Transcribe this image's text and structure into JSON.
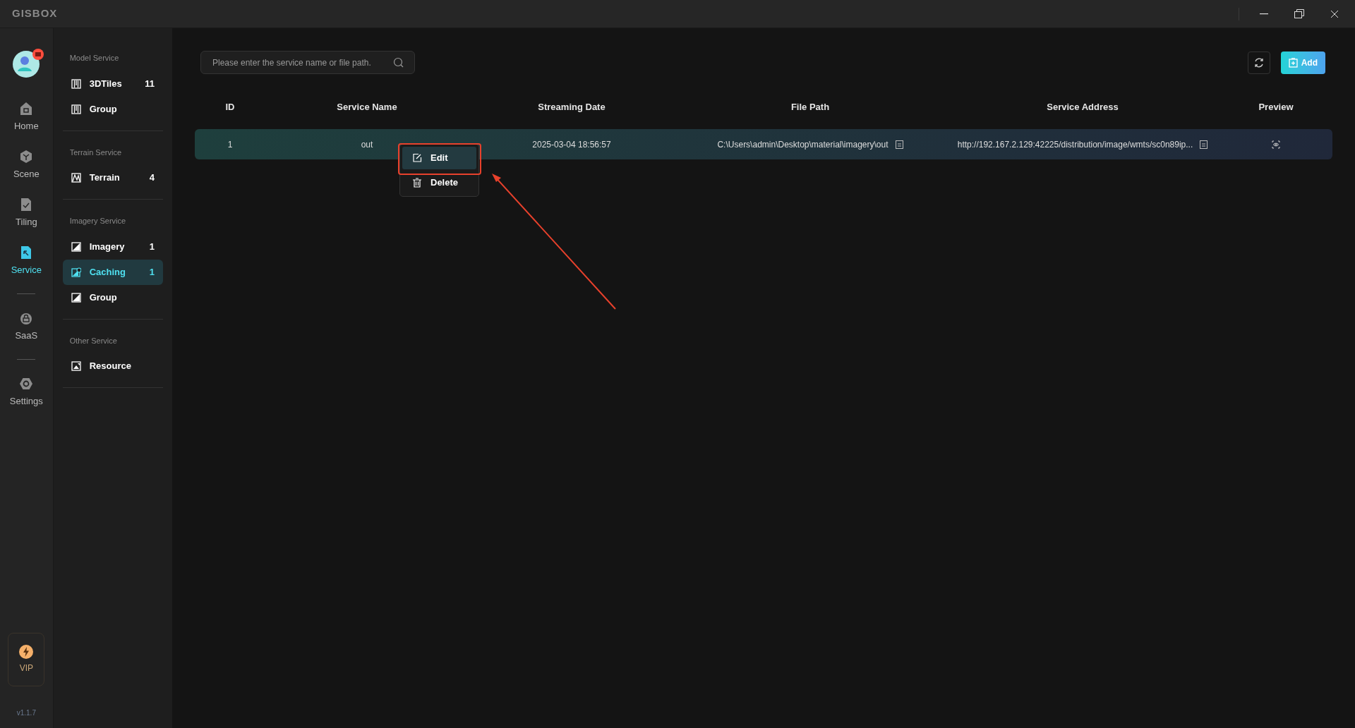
{
  "window": {
    "logo": "GISBOX"
  },
  "nav_rail": {
    "items": [
      {
        "label": "Home",
        "selected": false
      },
      {
        "label": "Scene",
        "selected": false
      },
      {
        "label": "Tiling",
        "selected": false
      },
      {
        "label": "Service",
        "selected": true
      },
      {
        "label": "SaaS",
        "selected": false
      },
      {
        "label": "Settings",
        "selected": false
      }
    ],
    "vip": "VIP",
    "version": "v1.1.7"
  },
  "sidebar": {
    "sections": [
      {
        "title": "Model Service",
        "items": [
          {
            "label": "3DTiles",
            "count": "11",
            "selected": false
          },
          {
            "label": "Group",
            "selected": false
          }
        ]
      },
      {
        "title": "Terrain Service",
        "items": [
          {
            "label": "Terrain",
            "count": "4",
            "selected": false
          }
        ]
      },
      {
        "title": "Imagery Service",
        "items": [
          {
            "label": "Imagery",
            "count": "1",
            "selected": false
          },
          {
            "label": "Caching",
            "count": "1",
            "selected": true
          },
          {
            "label": "Group",
            "selected": false
          }
        ]
      },
      {
        "title": "Other Service",
        "items": [
          {
            "label": "Resource",
            "selected": false
          }
        ]
      }
    ]
  },
  "toolbar": {
    "search": {
      "placeholder": "Please enter the service name or file path."
    },
    "add_button": "Add"
  },
  "table": {
    "columns": [
      "ID",
      "Service Name",
      "Streaming Date",
      "File Path",
      "Service Address",
      "Preview"
    ],
    "rows": [
      {
        "id": "1",
        "service_name": "out",
        "streaming_date": "2025-03-04 18:56:57",
        "file_path": "C:\\Users\\admin\\Desktop\\material\\imagery\\out",
        "service_address": "http://192.167.2.129:42225/distribution/image/wmts/sc0n89ip...",
        "selected": true
      }
    ]
  },
  "context_menu": {
    "items": [
      {
        "label": "Edit",
        "selected": true
      },
      {
        "label": "Delete",
        "selected": false
      }
    ]
  }
}
